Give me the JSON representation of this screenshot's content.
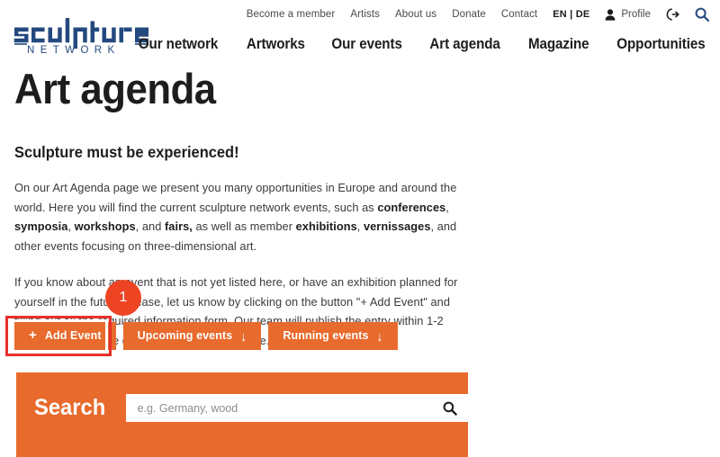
{
  "brand": {
    "name": "sculpture",
    "sub": "N E T W O R K",
    "color": "#24497F"
  },
  "topnav": {
    "items": [
      {
        "label": "Become a member",
        "name": "become-a-member"
      },
      {
        "label": "Artists",
        "name": "artists"
      },
      {
        "label": "About us",
        "name": "about-us"
      },
      {
        "label": "Donate",
        "name": "donate"
      },
      {
        "label": "Contact",
        "name": "contact"
      }
    ],
    "language": "EN | DE",
    "profile_label": "Profile",
    "icons": {
      "person": "person-icon",
      "logout": "logout-icon",
      "search": "search-icon"
    }
  },
  "mainnav": {
    "items": [
      {
        "label": "Our network"
      },
      {
        "label": "Artworks"
      },
      {
        "label": "Our events"
      },
      {
        "label": "Art agenda"
      },
      {
        "label": "Magazine"
      },
      {
        "label": "Opportunities"
      }
    ]
  },
  "main": {
    "title": "Art agenda",
    "subheading": "Sculpture must be experienced!",
    "paragraph_1": {
      "p1": "On our Art Agenda page we present you many opportunities in Europe and around the world. Here you will find the current sculpture network events, such as ",
      "b1": "conferences",
      "p2": ", ",
      "b2": "symposia",
      "p3": ", ",
      "b3": "workshops",
      "p4": ", and ",
      "b4": "fairs,",
      "p5": " as well as member ",
      "b5": "exhibitions",
      "p6": ", ",
      "b6": "vernissages",
      "p7": ", and other events focusing on three-dimensional art."
    },
    "paragraph_2": "If you know about an event that is not yet listed here, or have an exhibition planned for yourself in the future, please, let us know by clicking on the button \"+ Add Event\" and filling out all the required information form. Our team will publish the entry within 1-2 working days, so we can all enjoy the experience."
  },
  "buttons": {
    "add_event": {
      "plus": "+",
      "label": "Add Event"
    },
    "upcoming": {
      "label": "Upcoming events",
      "arrow": "↓"
    },
    "running": {
      "label": "Running events",
      "arrow": "↓"
    }
  },
  "annotation": {
    "badge_number": "1",
    "highlight_color": "#E8312A",
    "badge_color": "#EE4424"
  },
  "search": {
    "label": "Search",
    "placeholder": "e.g. Germany, wood",
    "value": "",
    "icon": "search-icon"
  },
  "theme": {
    "orange": "#E86A2D",
    "navy": "#24497F",
    "text": "#3a3a3a"
  }
}
